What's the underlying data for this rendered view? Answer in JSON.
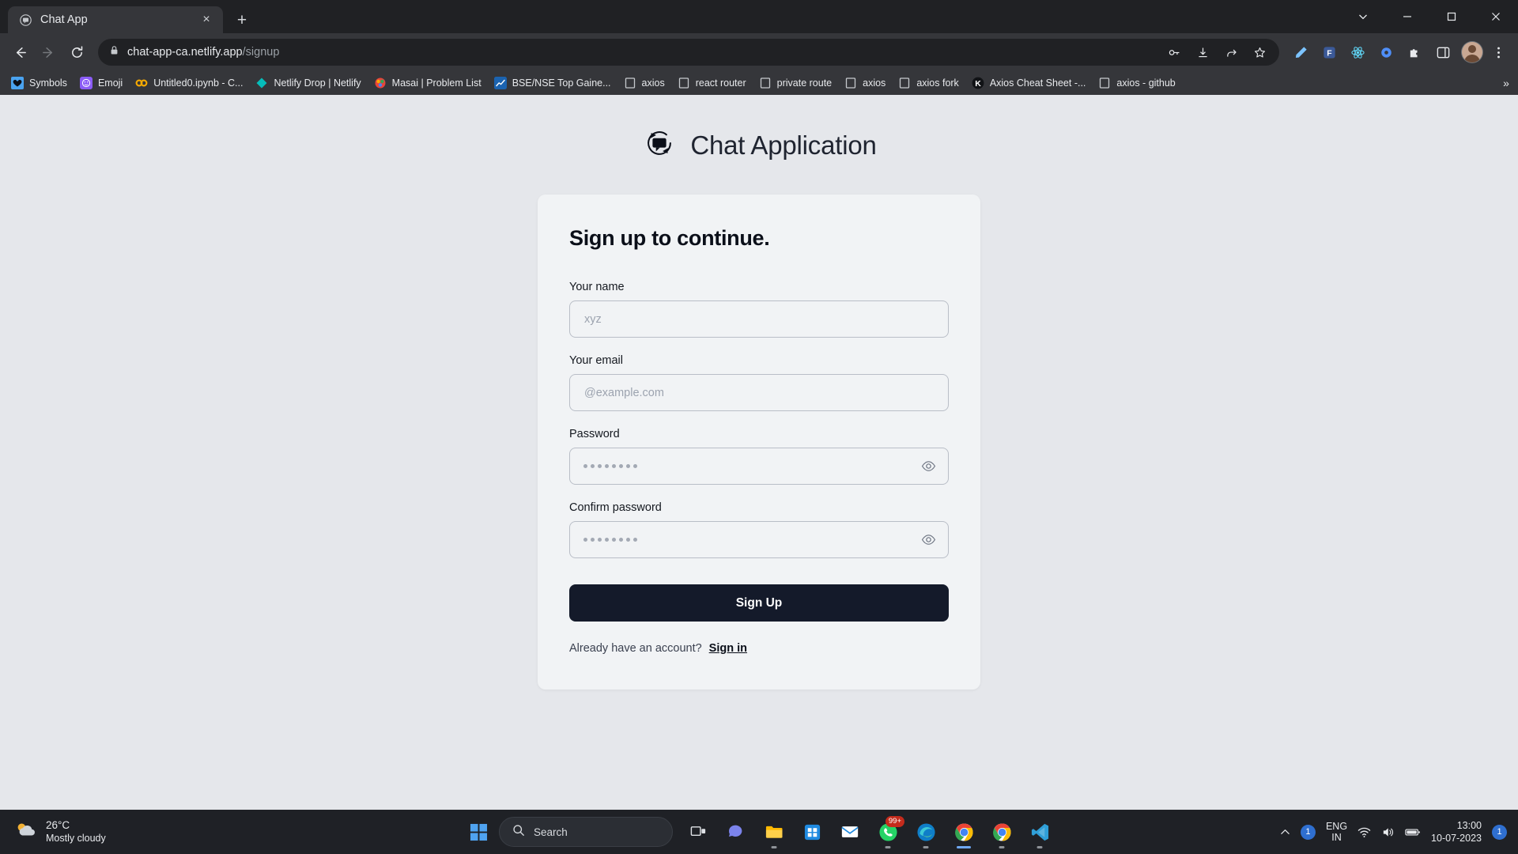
{
  "browser": {
    "tab": {
      "title": "Chat App",
      "favicon": "chat-app-favicon",
      "close_label": "×"
    },
    "new_tab_label": "+",
    "window_controls": {
      "minimize": "–",
      "maximize": "▢",
      "close": "×",
      "collapse": "⌄"
    },
    "nav": {
      "back": "←",
      "forward": "→",
      "reload": "⟳"
    },
    "omnibox": {
      "lock_icon": "lock-icon",
      "domain": "chat-app-ca.netlify.app",
      "path": "/signup",
      "icons": [
        "password-key-icon",
        "download-icon",
        "share-icon",
        "bookmark-star-icon"
      ]
    },
    "toolbar_extensions": [
      "pen-icon",
      "forms-extension-icon",
      "react-devtools-icon",
      "settings-gear-icon",
      "puzzle-extensions-icon",
      "side-panel-icon"
    ],
    "profile": "avatar",
    "menu_icon": "three-dot-menu-icon",
    "bookmarks": [
      {
        "label": "Symbols",
        "icon": "heart-icon"
      },
      {
        "label": "Emoji",
        "icon": "emoji-icon"
      },
      {
        "label": "Untitled0.ipynb - C...",
        "icon": "colab-icon"
      },
      {
        "label": "Netlify Drop | Netlify",
        "icon": "netlify-icon"
      },
      {
        "label": "Masai | Problem List",
        "icon": "masai-icon"
      },
      {
        "label": "BSE/NSE Top Gaine...",
        "icon": "chart-icon"
      },
      {
        "label": "axios",
        "icon": "generic-page-icon"
      },
      {
        "label": "react router",
        "icon": "generic-page-icon"
      },
      {
        "label": "private route",
        "icon": "generic-page-icon"
      },
      {
        "label": "axios",
        "icon": "generic-page-icon"
      },
      {
        "label": "axios fork",
        "icon": "generic-page-icon"
      },
      {
        "label": "Axios Cheat Sheet -...",
        "icon": "kindacode-k-icon"
      },
      {
        "label": "axios - github",
        "icon": "generic-page-icon"
      }
    ],
    "bookmarks_overflow": "»"
  },
  "page": {
    "logo_icon": "chat-refresh-logo",
    "app_title": "Chat Application",
    "card": {
      "heading": "Sign up to continue.",
      "fields": [
        {
          "label": "Your name",
          "placeholder": "xyz",
          "value": "",
          "type": "text",
          "name": "name"
        },
        {
          "label": "Your email",
          "placeholder": "@example.com",
          "value": "",
          "type": "email",
          "name": "email"
        },
        {
          "label": "Password",
          "placeholder": "",
          "value": "••••••••",
          "type": "password",
          "name": "password",
          "toggle_icon": "eye-icon"
        },
        {
          "label": "Confirm password",
          "placeholder": "",
          "value": "••••••••",
          "type": "password",
          "name": "confirm-password",
          "toggle_icon": "eye-icon"
        }
      ],
      "submit_label": "Sign Up",
      "footer_text": "Already have an account?",
      "footer_link": "Sign in"
    },
    "colors": {
      "page_bg": "#e5e7eb",
      "card_bg": "#f1f3f5",
      "button_bg": "#141a2a",
      "button_text": "#ffffff",
      "input_border": "#b9bec7"
    }
  },
  "taskbar": {
    "weather": {
      "temperature": "26°C",
      "description": "Mostly cloudy",
      "icon": "partly-cloudy-icon"
    },
    "start_icon": "windows-start-icon",
    "search_placeholder": "Search",
    "search_icon": "search-icon",
    "apps": [
      {
        "name": "task-view",
        "icon": "task-view-icon",
        "state": "idle"
      },
      {
        "name": "chat-teams",
        "icon": "teams-chat-icon",
        "state": "idle"
      },
      {
        "name": "file-explorer",
        "icon": "file-explorer-icon",
        "state": "running"
      },
      {
        "name": "microsoft-store",
        "icon": "microsoft-store-icon",
        "state": "idle"
      },
      {
        "name": "mail",
        "icon": "mail-icon",
        "state": "idle"
      },
      {
        "name": "whatsapp",
        "icon": "whatsapp-icon",
        "state": "running",
        "badge": "99+"
      },
      {
        "name": "edge",
        "icon": "edge-icon",
        "state": "running"
      },
      {
        "name": "chrome-active",
        "icon": "chrome-icon",
        "state": "active"
      },
      {
        "name": "chrome-second",
        "icon": "chrome-icon",
        "state": "running"
      },
      {
        "name": "vs-code",
        "icon": "vscode-icon",
        "state": "running"
      }
    ],
    "tray": {
      "chevron": "show-hidden-icons-chevron",
      "notification_count": "1",
      "language": {
        "line1": "ENG",
        "line2": "IN"
      },
      "icons": [
        "wifi-icon",
        "volume-icon",
        "battery-icon"
      ],
      "time": "13:00",
      "date": "10-07-2023",
      "notification_badge": "1"
    }
  }
}
